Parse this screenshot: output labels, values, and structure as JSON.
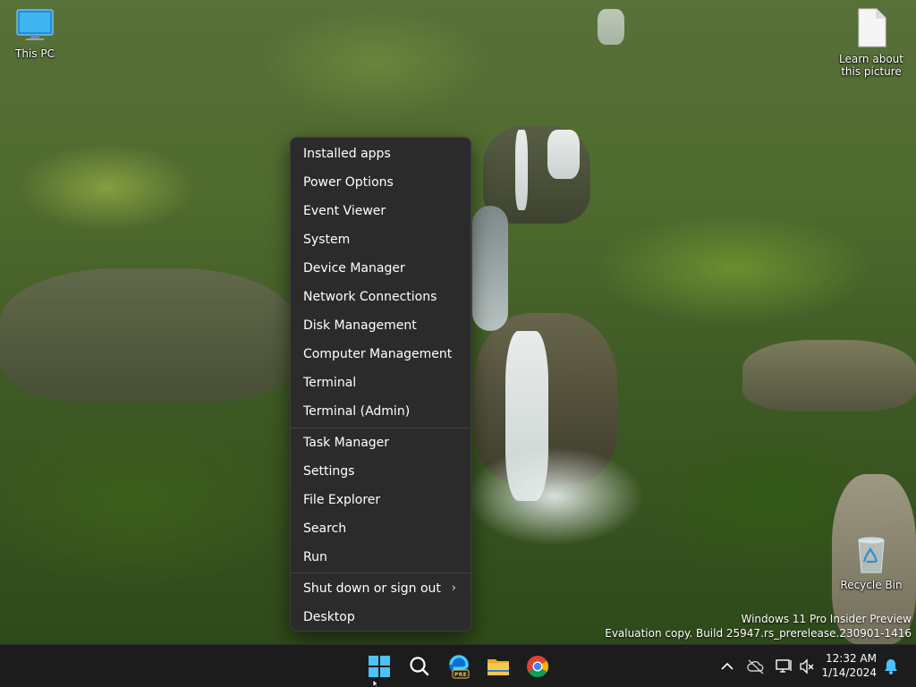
{
  "desktop": {
    "icons": [
      {
        "label": "This PC",
        "icon": "monitor-icon"
      },
      {
        "label": "Learn about this picture",
        "icon": "document-icon"
      },
      {
        "label": "Recycle Bin",
        "icon": "recycle-bin-icon"
      }
    ]
  },
  "context_menu": {
    "items": [
      "Installed apps",
      "Power Options",
      "Event Viewer",
      "System",
      "Device Manager",
      "Network Connections",
      "Disk Management",
      "Computer Management",
      "Terminal",
      "Terminal (Admin)",
      "Task Manager",
      "Settings",
      "File Explorer",
      "Search",
      "Run",
      "Shut down or sign out",
      "Desktop"
    ],
    "submenu_chevron": "›"
  },
  "watermark": {
    "line1": "Windows 11 Pro Insider Preview",
    "line2": "Evaluation copy. Build 25947.rs_prerelease.230901-1416"
  },
  "taskbar": {
    "apps": [
      {
        "name": "Start",
        "icon": "windows-start-icon"
      },
      {
        "name": "Search",
        "icon": "search-icon"
      },
      {
        "name": "Microsoft Edge",
        "icon": "edge-pre-icon",
        "badge": "PRE"
      },
      {
        "name": "File Explorer",
        "icon": "folder-icon"
      },
      {
        "name": "Google Chrome",
        "icon": "chrome-icon"
      }
    ],
    "clock": {
      "time": "12:32 AM",
      "date": "1/14/2024"
    }
  },
  "colors": {
    "menu_bg": "#2b2b2b",
    "taskbar_bg": "#1c1c1c",
    "accent": "#4cc2ff"
  }
}
